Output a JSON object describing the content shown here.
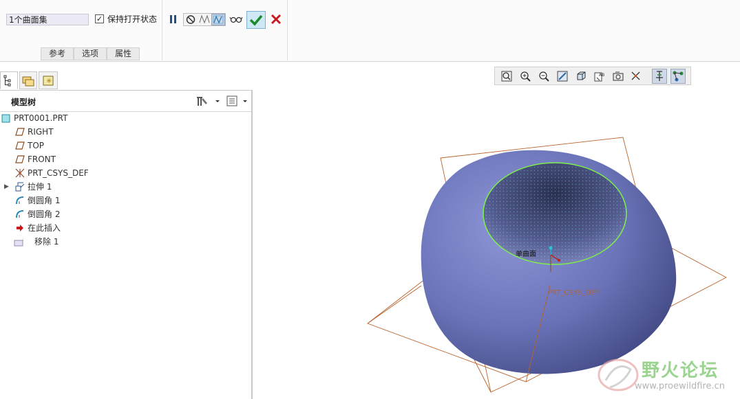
{
  "ribbon": {
    "selection_value": "1个曲面集",
    "keep_open_checked": true,
    "keep_open_label": "保持打开状态",
    "tabs": [
      {
        "label": "参考"
      },
      {
        "label": "选项"
      },
      {
        "label": "属性"
      }
    ]
  },
  "view_toolbar": {
    "buttons": [
      "refit-icon",
      "zoom-in-icon",
      "zoom-out-icon",
      "repaint-icon",
      "display-style-icon",
      "saved-views-icon",
      "view-manager-icon",
      "datum-display-icon",
      "annotation-display-icon",
      "spin-center-icon"
    ]
  },
  "model_tree": {
    "title": "模型树",
    "items": [
      {
        "label": "PRT0001.PRT",
        "icon": "part-icon"
      },
      {
        "label": "RIGHT",
        "icon": "datum-plane-icon"
      },
      {
        "label": "TOP",
        "icon": "datum-plane-icon"
      },
      {
        "label": "FRONT",
        "icon": "datum-plane-icon"
      },
      {
        "label": "PRT_CSYS_DEF",
        "icon": "csys-icon"
      },
      {
        "label": "拉伸 1",
        "icon": "extrude-icon"
      },
      {
        "label": "倒圆角 1",
        "icon": "round-icon"
      },
      {
        "label": "倒圆角 2",
        "icon": "round-icon"
      },
      {
        "label": "在此插入",
        "icon": "insert-here-icon"
      },
      {
        "label": "移除 1",
        "icon": "remove-icon"
      }
    ]
  },
  "viewport": {
    "surface_label": "单曲面",
    "csys_label": "PRT_CSYS_DEF",
    "model_color": "#6a73b8"
  },
  "watermark": {
    "name": "野火论坛",
    "url": "www.proewildfire.cn"
  }
}
